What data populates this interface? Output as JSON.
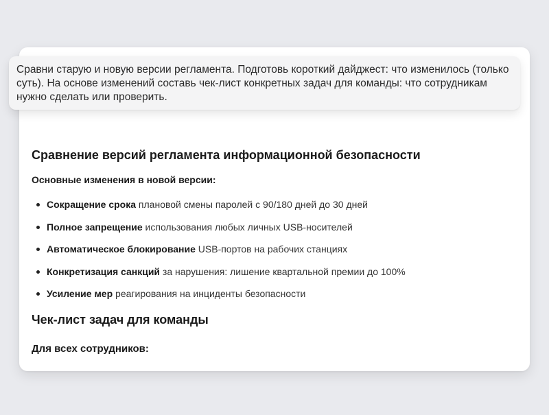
{
  "prompt": {
    "text": "Сравни старую и новую версии регламента. Подготовь короткий дайджест: что изменилось (только суть). На основе изменений составь чек-лист конкретных задач для команды: что сотрудникам нужно сделать или проверить."
  },
  "response": {
    "title": "Сравнение версий регламента информационной безопасности",
    "changes_heading": "Основные изменения в новой версии:",
    "changes": [
      {
        "bold": "Сокращение срока",
        "rest": " плановой смены паролей с 90/180 дней до 30 дней"
      },
      {
        "bold": "Полное запрещение",
        "rest": " использования любых личных USB-носителей"
      },
      {
        "bold": "Автоматическое блокирование",
        "rest": " USB-портов на рабочих станциях"
      },
      {
        "bold": "Конкретизация санкций",
        "rest": " за нарушения: лишение квартальной премии до 100%"
      },
      {
        "bold": "Усиление мер",
        "rest": " реагирования на инциденты безопасности"
      }
    ],
    "checklist_title": "Чек-лист задач для команды",
    "all_employees_heading": "Для всех сотрудников:"
  }
}
